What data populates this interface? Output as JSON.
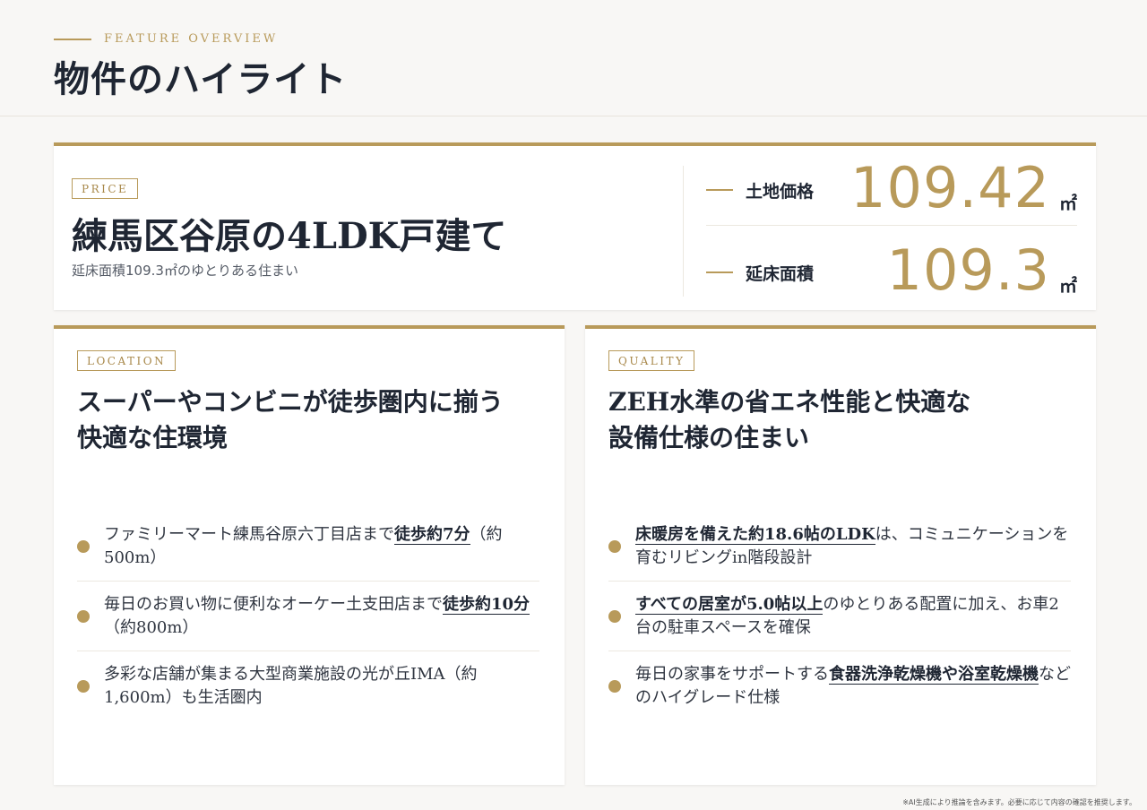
{
  "header": {
    "eyebrow": "FEATURE OVERVIEW",
    "title": "物件のハイライト"
  },
  "price": {
    "tag": "PRICE",
    "headline": "練馬区谷原の4LDK戸建て",
    "sub": "延床面積109.3㎡のゆとりある住まい",
    "stats": [
      {
        "label": "土地価格",
        "value": "109.42",
        "unit": "㎡"
      },
      {
        "label": "延床面積",
        "value": "109.3",
        "unit": "㎡"
      }
    ]
  },
  "location": {
    "tag": "LOCATION",
    "title_line1": "スーパーやコンビニが徒歩圏内に揃う",
    "title_line2": "快適な住環境",
    "items": [
      {
        "pre": "ファミリーマート練馬谷原六丁目店まで",
        "em": "徒歩約7分",
        "post": "（約500m）"
      },
      {
        "pre": "毎日のお買い物に便利なオーケー土支田店まで",
        "em": "徒歩約10分",
        "post": "（約800m）"
      },
      {
        "pre": "多彩な店舗が集まる大型商業施設の光が丘IMA（約1,600m）も生活圏内",
        "em": "",
        "post": ""
      }
    ]
  },
  "quality": {
    "tag": "QUALITY",
    "title_line1": "ZEH水準の省エネ性能と快適な",
    "title_line2": "設備仕様の住まい",
    "items": [
      {
        "pre": "",
        "em": "床暖房を備えた約18.6帖のLDK",
        "post": "は、コミュニケーションを育むリビングin階段設計"
      },
      {
        "pre": "",
        "em": "すべての居室が5.0帖以上",
        "post": "のゆとりある配置に加え、お車2台の駐車スペースを確保"
      },
      {
        "pre": "毎日の家事をサポートする",
        "em": "食器洗浄乾燥機や浴室乾燥機",
        "post": "などのハイグレード仕様"
      }
    ]
  },
  "footer": {
    "disclaimer": "※AI生成により推論を含みます。必要に応じて内容の確認を推奨します。"
  },
  "colors": {
    "accent": "#b89a5a",
    "text": "#1f2633",
    "background": "#f8f7f5"
  }
}
